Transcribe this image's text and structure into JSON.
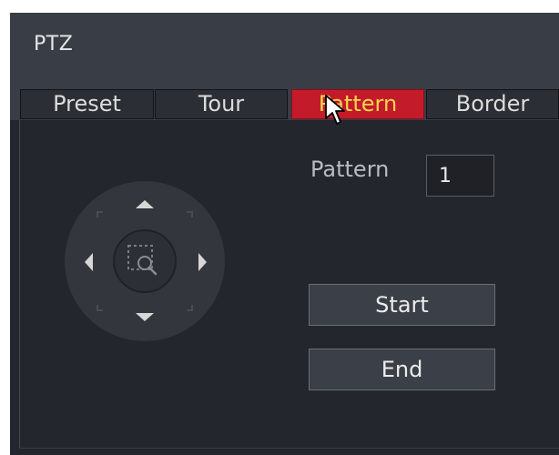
{
  "window": {
    "title": "PTZ"
  },
  "tabs": [
    {
      "label": "Preset",
      "active": false
    },
    {
      "label": "Tour",
      "active": false
    },
    {
      "label": "Pattern",
      "active": true
    },
    {
      "label": "Border",
      "active": false
    }
  ],
  "pattern": {
    "label": "Pattern",
    "value": "1"
  },
  "buttons": {
    "start": "Start",
    "end": "End"
  },
  "ptz_pad": {
    "icons": [
      "arrow-up-icon",
      "arrow-down-icon",
      "arrow-left-icon",
      "arrow-right-icon",
      "zoom-area-icon"
    ]
  },
  "colors": {
    "active_tab": "#c41b2b",
    "active_tab_text": "#f2d64d",
    "background": "#23262d",
    "header": "#393d45"
  }
}
